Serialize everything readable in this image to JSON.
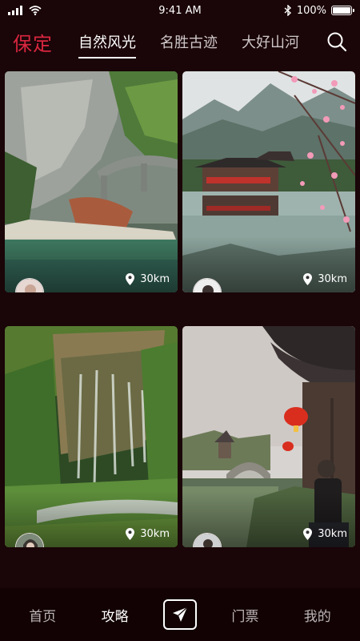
{
  "status": {
    "time": "9:41 AM",
    "battery": "100%",
    "battery_level": 1.0
  },
  "header": {
    "city": "保定",
    "tabs": [
      {
        "label": "自然风光",
        "active": true
      },
      {
        "label": "名胜古迹",
        "active": false
      },
      {
        "label": "大好山河",
        "active": false
      }
    ]
  },
  "cards": [
    {
      "distance": "30km"
    },
    {
      "distance": "30km"
    },
    {
      "distance": "30km"
    },
    {
      "distance": "30km"
    }
  ],
  "nav": {
    "items": [
      "首页",
      "攻略",
      "门票",
      "我的"
    ],
    "active": "攻略"
  },
  "colors": {
    "accent": "#d9263f",
    "background": "#1a0508"
  },
  "icons": [
    "signal-icon",
    "wifi-icon",
    "bluetooth-icon",
    "battery-icon",
    "search-icon",
    "location-pin-icon",
    "send-icon"
  ]
}
